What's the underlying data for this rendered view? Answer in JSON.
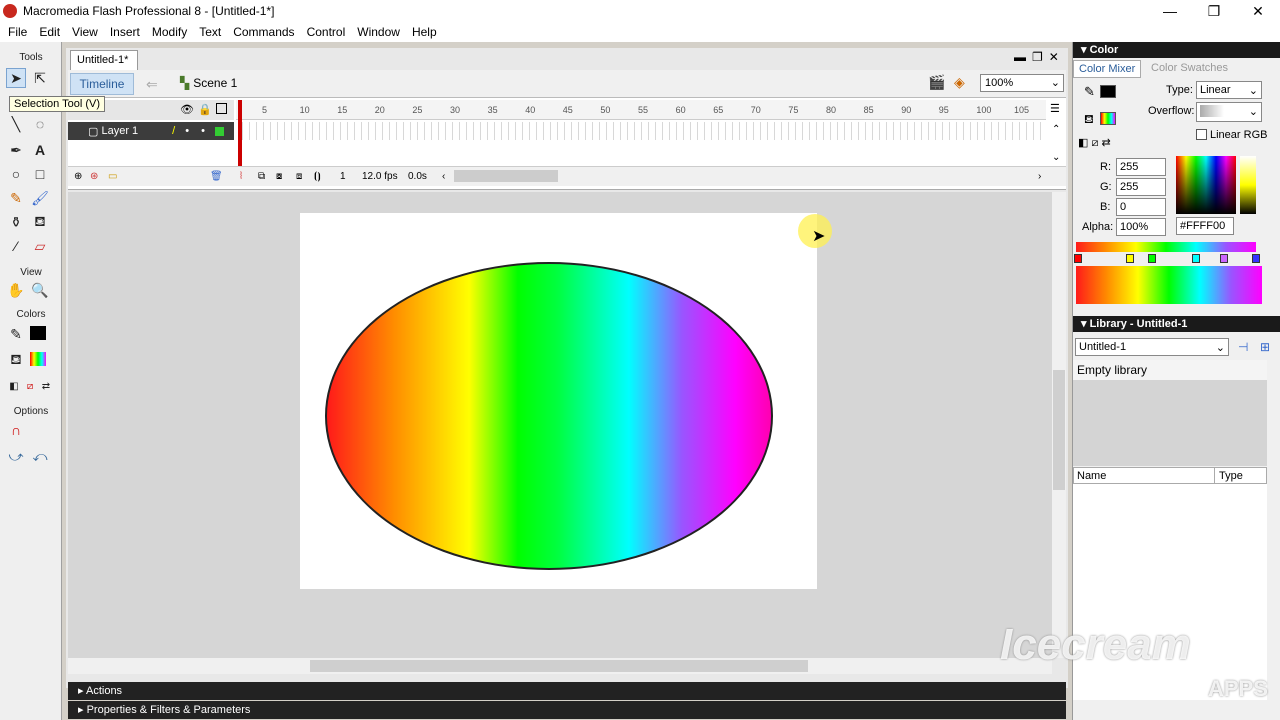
{
  "window": {
    "title": "Macromedia Flash Professional 8 - [Untitled-1*]",
    "minimize": "—",
    "restore": "❐",
    "close": "✕"
  },
  "menu": [
    "File",
    "Edit",
    "View",
    "Insert",
    "Modify",
    "Text",
    "Commands",
    "Control",
    "Window",
    "Help"
  ],
  "tools": {
    "heading": "Tools",
    "tooltip": "Selection Tool (V)",
    "view": "View",
    "colors": "Colors",
    "options": "Options"
  },
  "document": {
    "tab": "Untitled-1*",
    "timeline_button": "Timeline",
    "scene": "Scene 1",
    "zoom": "100%"
  },
  "timeline": {
    "layer": "Layer 1",
    "ruler": [
      "5",
      "10",
      "15",
      "20",
      "25",
      "30",
      "35",
      "40",
      "45",
      "50",
      "55",
      "60",
      "65",
      "70",
      "75",
      "80",
      "85",
      "90",
      "95",
      "100",
      "105"
    ],
    "frame": "1",
    "fps": "12.0 fps",
    "time": "0.0s"
  },
  "bottom_panels": {
    "actions": "Actions",
    "properties": "Properties & Filters & Parameters"
  },
  "color_panel": {
    "title": "Color",
    "tab_mixer": "Color Mixer",
    "tab_swatches": "Color Swatches",
    "type_label": "Type:",
    "type_value": "Linear",
    "overflow_label": "Overflow:",
    "linear_rgb": "Linear RGB",
    "r_label": "R:",
    "r_value": "255",
    "g_label": "G:",
    "g_value": "255",
    "b_label": "B:",
    "b_value": "0",
    "alpha_label": "Alpha:",
    "alpha_value": "100%",
    "hex": "#FFFF00"
  },
  "library_panel": {
    "title": "Library - Untitled-1",
    "doc": "Untitled-1",
    "empty": "Empty library",
    "col_name": "Name",
    "col_type": "Type"
  },
  "watermark": {
    "brand": "Icecream",
    "sub": "APPS"
  }
}
